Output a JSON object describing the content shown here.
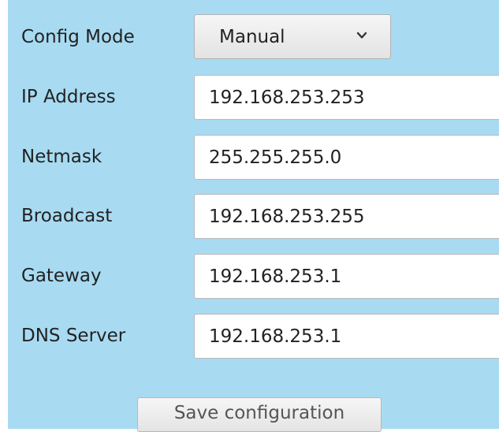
{
  "form": {
    "config_mode": {
      "label": "Config Mode",
      "value": "Manual",
      "icon": "chevron-down-icon"
    },
    "ip_address": {
      "label": "IP Address",
      "value": "192.168.253.253"
    },
    "netmask": {
      "label": "Netmask",
      "value": "255.255.255.0"
    },
    "broadcast": {
      "label": "Broadcast",
      "value": "192.168.253.255"
    },
    "gateway": {
      "label": "Gateway",
      "value": "192.168.253.1"
    },
    "dns_server": {
      "label": "DNS Server",
      "value": "192.168.253.1"
    },
    "save_label": "Save configuration"
  },
  "colors": {
    "panel_background": "#a8dbf2",
    "field_background": "#ffffff",
    "text": "#222222"
  }
}
